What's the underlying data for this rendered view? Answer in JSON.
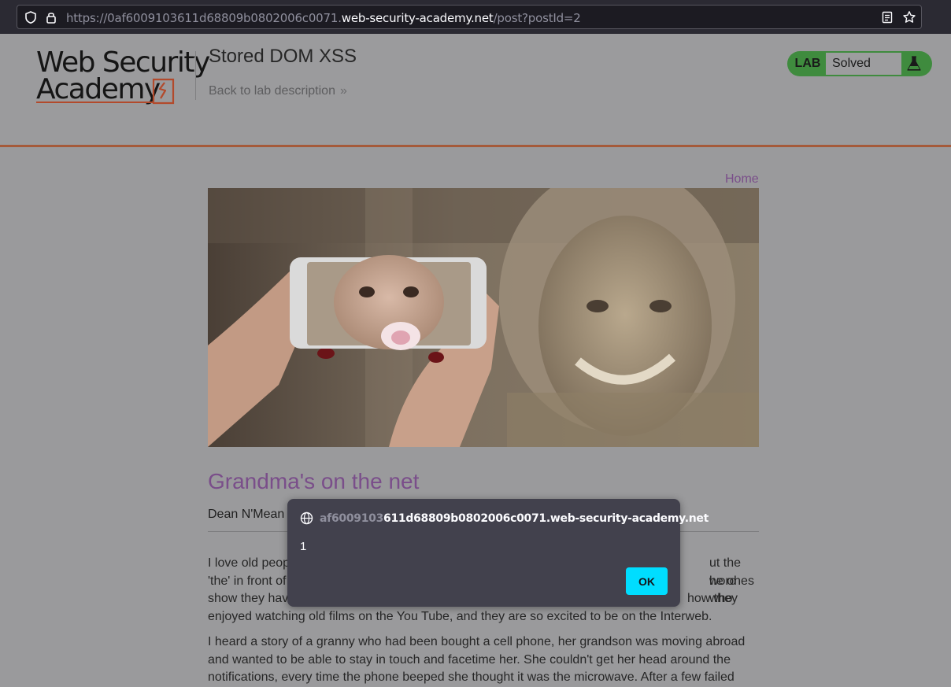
{
  "browser": {
    "url_prefix": "https://0af6009103611d68809b0802006c0071.",
    "url_host": "web-security-academy.net",
    "url_path": "/post?postId=2",
    "icons": [
      "shield-icon",
      "lock-icon",
      "reader-view-icon",
      "bookmark-star-icon"
    ]
  },
  "header": {
    "logo_line1": "Web Security",
    "logo_line2": "Academy",
    "lab_title": "Stored DOM XSS",
    "back_link": "Back to lab description",
    "back_chevron": "»",
    "lab_badge": "LAB",
    "lab_status": "Solved",
    "accent_color": "#a55a3a"
  },
  "main": {
    "home_link": "Home",
    "post_title": "Grandma's on the net",
    "author": "Dean N'Mean",
    "paragraphs": [
      "I love old peop",
      "ut the word",
      "'the' in front of",
      "he ones who",
      "show they hav",
      "how they",
      "enjoyed watching old films on the You Tube, and they are so excited to be on the Interweb.",
      "I heard a story of a granny who had been bought a cell phone, her grandson was moving abroad",
      "and wanted to be able to stay in touch and facetime her. She couldn't get her head around the",
      "notifications, every time the phone beeped she thought it was the microwave. After a few failed"
    ]
  },
  "dialog": {
    "origin_faded": "af6009103",
    "origin_rest": "611d68809b0802006c0071.web-security-academy.net",
    "message": "1",
    "ok_label": "OK",
    "ok_color": "#00ddff"
  }
}
